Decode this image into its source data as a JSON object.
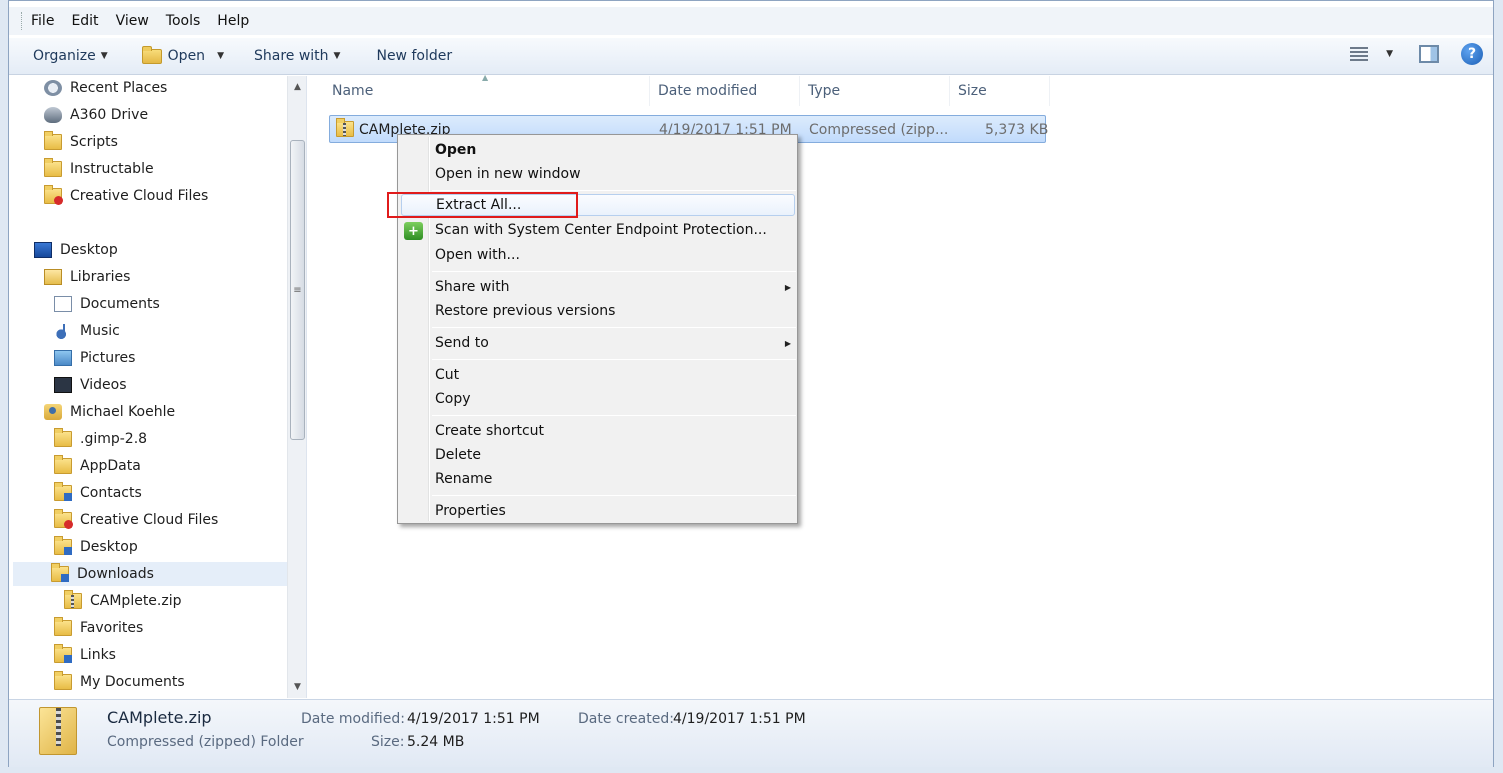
{
  "menu": [
    "File",
    "Edit",
    "View",
    "Tools",
    "Help"
  ],
  "toolbar": {
    "organize": "Organize",
    "open": "Open",
    "share_with": "Share with",
    "new_folder": "New folder"
  },
  "nav": {
    "recent_places": "Recent Places",
    "a360_drive": "A360 Drive",
    "scripts": "Scripts",
    "instructable": "Instructable",
    "creative_cloud_top": "Creative Cloud Files",
    "desktop": "Desktop",
    "libraries": "Libraries",
    "documents": "Documents",
    "music": "Music",
    "pictures": "Pictures",
    "videos": "Videos",
    "user": "Michael Koehle",
    "gimp": ".gimp-2.8",
    "appdata": "AppData",
    "contacts": "Contacts",
    "creative_cloud": "Creative Cloud Files",
    "user_desktop": "Desktop",
    "downloads": "Downloads",
    "camplete": "CAMplete.zip",
    "favorites": "Favorites",
    "links": "Links",
    "my_documents": "My Documents"
  },
  "columns": {
    "name": "Name",
    "date_modified": "Date modified",
    "type": "Type",
    "size": "Size"
  },
  "file": {
    "name": "CAMplete.zip",
    "date": "4/19/2017 1:51 PM",
    "type": "Compressed (zipp...",
    "size": "5,373 KB"
  },
  "context_menu": {
    "open": "Open",
    "open_new_window": "Open in new window",
    "extract_all": "Extract All...",
    "scan": "Scan with System Center Endpoint Protection...",
    "open_with": "Open with...",
    "share_with": "Share with",
    "restore": "Restore previous versions",
    "send_to": "Send to",
    "cut": "Cut",
    "copy": "Copy",
    "create_shortcut": "Create shortcut",
    "delete": "Delete",
    "rename": "Rename",
    "properties": "Properties"
  },
  "details": {
    "name": "CAMplete.zip",
    "kind": "Compressed (zipped) Folder",
    "date_modified_label": "Date modified:",
    "date_modified": "4/19/2017 1:51 PM",
    "date_created_label": "Date created:",
    "date_created": "4/19/2017 1:51 PM",
    "size_label": "Size:",
    "size": "5.24 MB"
  },
  "colors": {
    "highlight_box": "#e01b1b",
    "selection": "#c1dbfc"
  }
}
